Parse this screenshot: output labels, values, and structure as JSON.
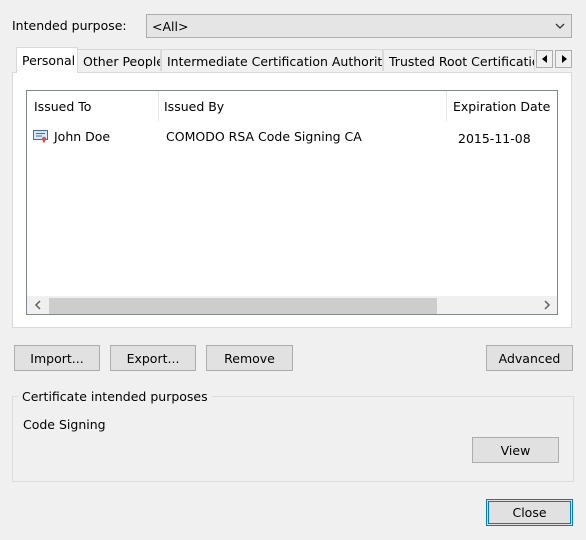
{
  "purpose": {
    "label": "Intended purpose:",
    "selected": "<All>"
  },
  "tabs": [
    {
      "label": "Personal",
      "active": true
    },
    {
      "label": "Other People",
      "active": false
    },
    {
      "label": "Intermediate Certification Authorities",
      "active": false
    },
    {
      "label": "Trusted Root Certification",
      "active": false
    }
  ],
  "list": {
    "columns": [
      "Issued To",
      "Issued By",
      "Expiration Date"
    ],
    "rows": [
      {
        "icon": "certificate-icon",
        "issued_to": "John Doe",
        "issued_by": "COMODO RSA Code Signing CA",
        "expiration": "2015-11-08"
      }
    ]
  },
  "buttons": {
    "import": "Import...",
    "export": "Export...",
    "remove": "Remove",
    "advanced": "Advanced",
    "view": "View",
    "close": "Close"
  },
  "purposes_group": {
    "title": "Certificate intended purposes",
    "value": "Code Signing"
  },
  "colors": {
    "background": "#f0f0f0",
    "default_button_border": "#0078d7"
  }
}
